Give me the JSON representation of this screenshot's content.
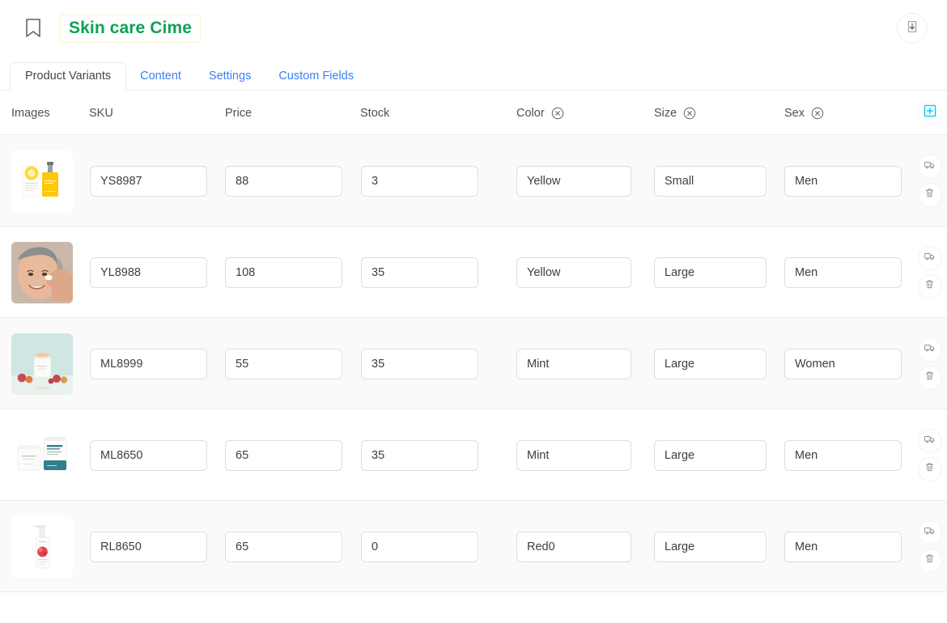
{
  "header": {
    "bookmark_icon": "bookmark-icon",
    "title": "Skin care Cime",
    "title_color": "#0aa356",
    "download_icon": "download-icon"
  },
  "tabs": [
    {
      "label": "Product Variants",
      "active": true
    },
    {
      "label": "Content",
      "active": false
    },
    {
      "label": "Settings",
      "active": false
    },
    {
      "label": "Custom Fields",
      "active": false
    }
  ],
  "table": {
    "columns": [
      {
        "key": "images",
        "label": "Images",
        "removable": false
      },
      {
        "key": "sku",
        "label": "SKU",
        "removable": false
      },
      {
        "key": "price",
        "label": "Price",
        "removable": false
      },
      {
        "key": "stock",
        "label": "Stock",
        "removable": false
      },
      {
        "key": "color",
        "label": "Color",
        "removable": true
      },
      {
        "key": "size",
        "label": "Size",
        "removable": true
      },
      {
        "key": "sex",
        "label": "Sex",
        "removable": true
      }
    ],
    "add_column_icon": "plus-square-icon",
    "add_column_color": "#00cdf0",
    "remove_column_icon": "circle-x-icon",
    "row_actions": [
      {
        "icon": "truck-icon",
        "name": "shipping-button"
      },
      {
        "icon": "trash-icon",
        "name": "delete-button"
      }
    ],
    "rows": [
      {
        "image": "yellow-serum-box-and-bottle",
        "sku": "YS8987",
        "price": "88",
        "stock": "3",
        "color": "Yellow",
        "size": "Small",
        "sex": "Men"
      },
      {
        "image": "woman-applying-cream-face",
        "sku": "YL8988",
        "price": "108",
        "stock": "35",
        "color": "Yellow",
        "size": "Large",
        "sex": "Men"
      },
      {
        "image": "white-jar-with-berries-mint-background",
        "sku": "ML8999",
        "price": "55",
        "stock": "35",
        "color": "Mint",
        "size": "Large",
        "sex": "Women"
      },
      {
        "image": "two-white-teal-jars",
        "sku": "ML8650",
        "price": "65",
        "stock": "35",
        "color": "Mint",
        "size": "Large",
        "sex": "Men"
      },
      {
        "image": "white-spray-bottle-red-label",
        "sku": "RL8650",
        "price": "65",
        "stock": "0",
        "color": "Red0",
        "size": "Large",
        "sex": "Men"
      }
    ]
  }
}
